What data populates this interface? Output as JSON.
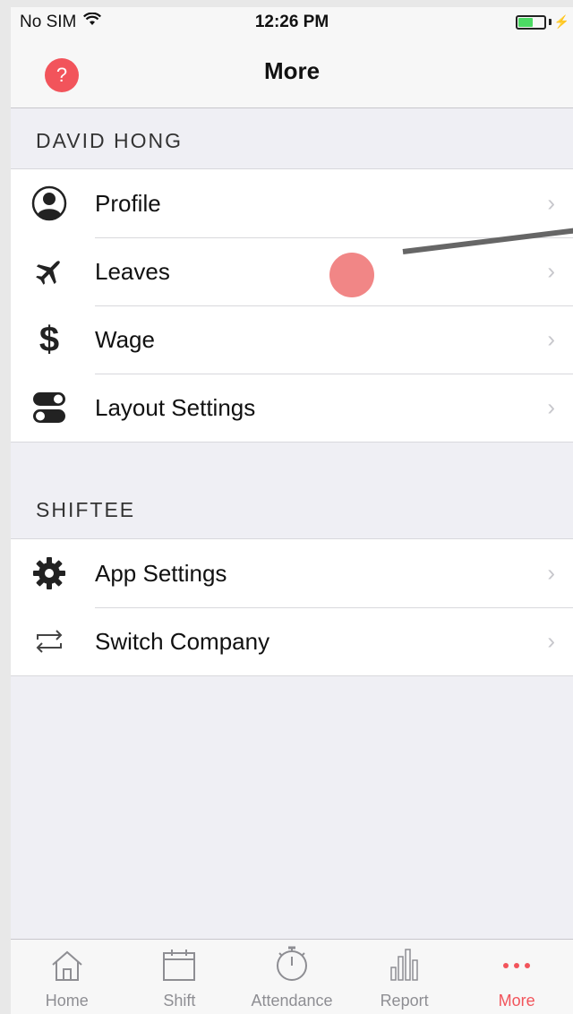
{
  "status": {
    "carrier": "No SIM",
    "time": "12:26 PM",
    "battery_color": "#4cd964"
  },
  "nav": {
    "title": "More",
    "help_label": "?"
  },
  "sections": [
    {
      "header": "DAVID HONG",
      "items": [
        {
          "label": "Profile",
          "icon": "profile-icon"
        },
        {
          "label": "Leaves",
          "icon": "airplane-icon"
        },
        {
          "label": "Wage",
          "icon": "dollar-icon"
        },
        {
          "label": "Layout Settings",
          "icon": "toggle-icon"
        }
      ]
    },
    {
      "header": "SHIFTEE",
      "items": [
        {
          "label": "App Settings",
          "icon": "gear-icon"
        },
        {
          "label": "Switch Company",
          "icon": "switch-icon"
        }
      ]
    }
  ],
  "tabs": [
    {
      "label": "Home",
      "icon": "home-icon"
    },
    {
      "label": "Shift",
      "icon": "calendar-icon"
    },
    {
      "label": "Attendance",
      "icon": "stopwatch-icon"
    },
    {
      "label": "Report",
      "icon": "bar-chart-icon"
    },
    {
      "label": "More",
      "icon": "more-dots-icon",
      "active": true
    }
  ],
  "colors": {
    "accent": "#f2545b",
    "chevron": "#c7c7cc"
  }
}
